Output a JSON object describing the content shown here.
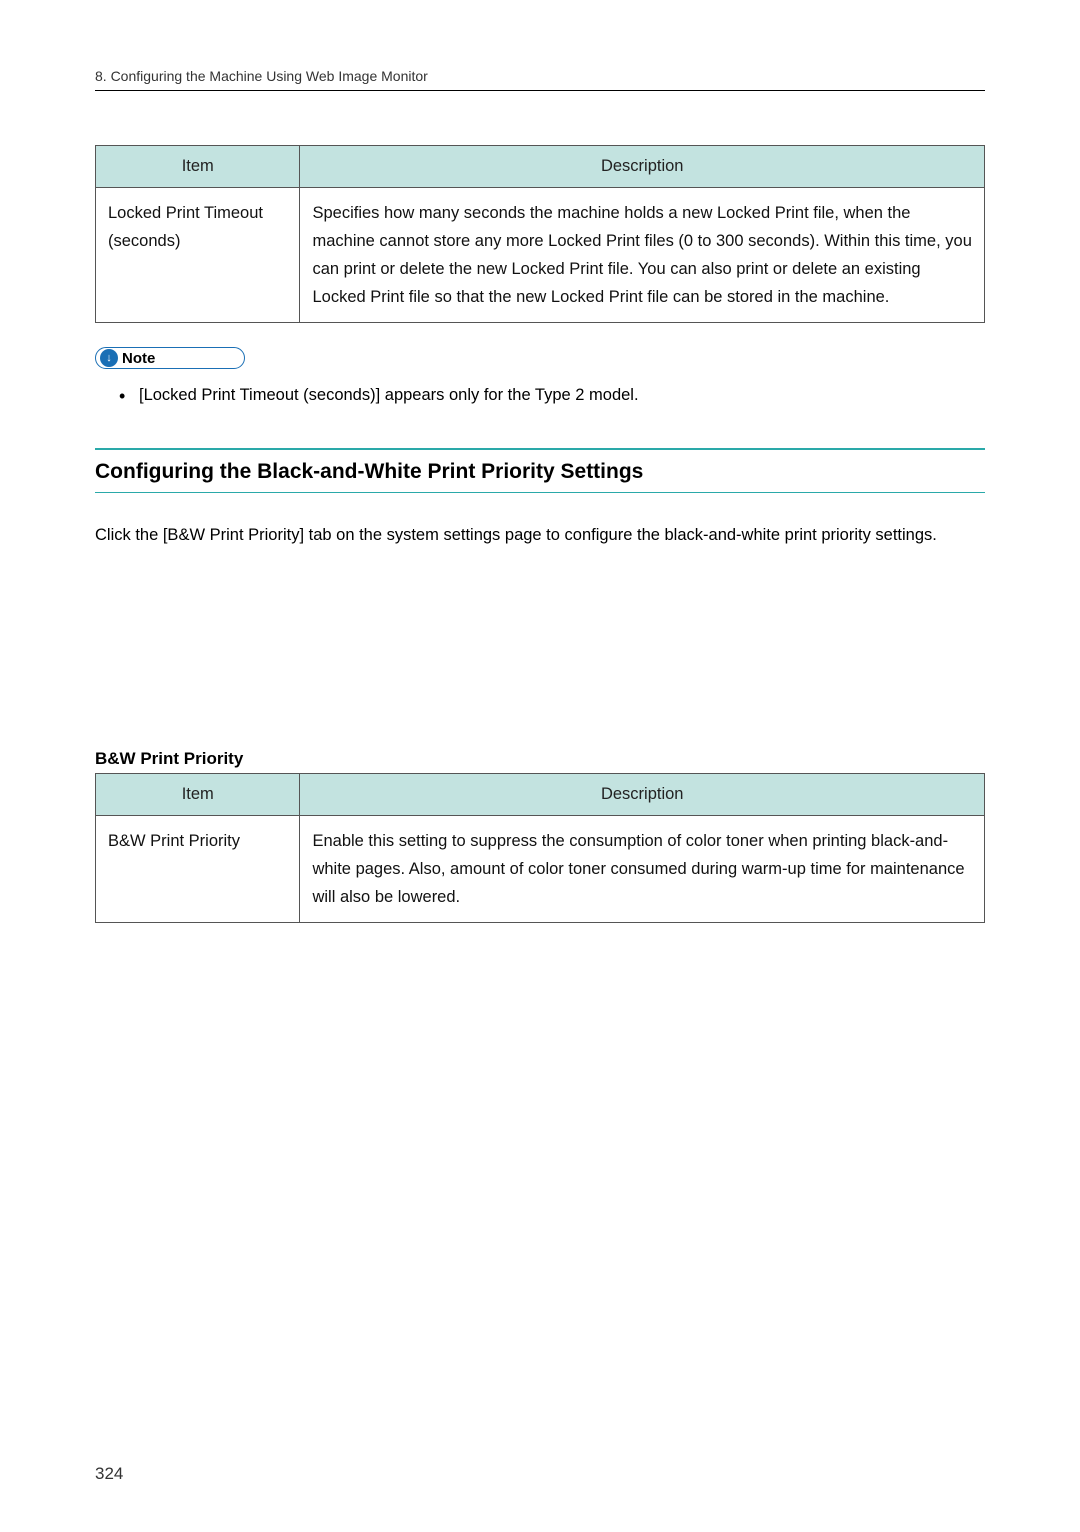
{
  "chapter_header": "8. Configuring the Machine Using Web Image Monitor",
  "table1": {
    "headers": {
      "item": "Item",
      "description": "Description"
    },
    "row": {
      "item": "Locked Print Timeout (seconds)",
      "description": "Specifies how many seconds the machine holds a new Locked Print file, when the machine cannot store any more Locked Print files (0 to 300 seconds). Within this time, you can print or delete the new Locked Print file. You can also print or delete an existing Locked Print file so that the new Locked Print file can be stored in the machine."
    }
  },
  "note_label": "Note",
  "note_bullet": "[Locked Print Timeout (seconds)] appears only for the Type 2 model.",
  "section_heading": "Configuring the Black-and-White Print Priority Settings",
  "body_paragraph": "Click the [B&W Print Priority] tab on the system settings page to configure the black-and-white print priority settings.",
  "sub_heading": "B&W Print Priority",
  "table2": {
    "headers": {
      "item": "Item",
      "description": "Description"
    },
    "row": {
      "item": "B&W Print Priority",
      "description": "Enable this setting to suppress the consumption of color toner when printing black-and-white pages. Also, amount of color toner consumed during warm-up time for maintenance will also be lowered."
    }
  },
  "page_number": "324"
}
